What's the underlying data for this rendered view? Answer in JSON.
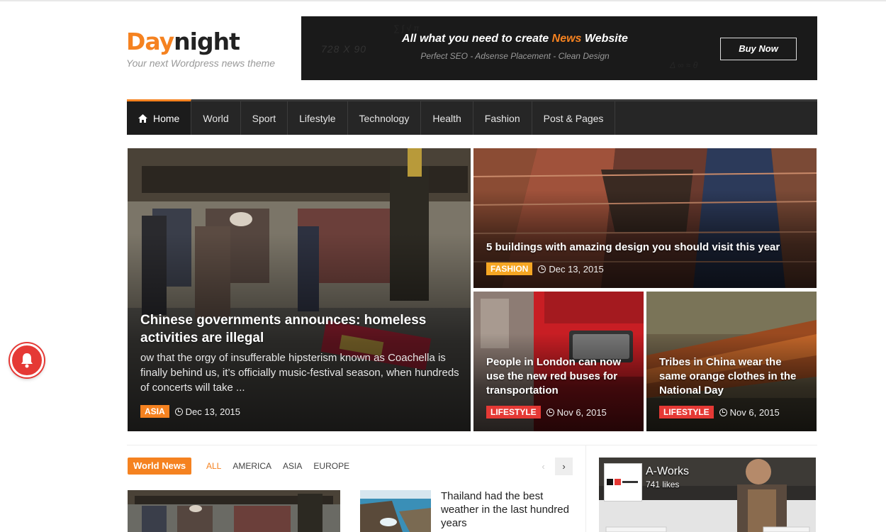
{
  "site": {
    "logo_day": "Day",
    "logo_night": "night",
    "tagline": "Your next Wordpress news theme"
  },
  "ad": {
    "size_text": "728 X 90",
    "headline_pre": "All what you need to create ",
    "headline_highlight": "News",
    "headline_post": " Website",
    "subline": "Perfect SEO - Adsense Placement - Clean Design",
    "button": "Buy Now"
  },
  "nav": {
    "items": [
      "Home",
      "World",
      "Sport",
      "Lifestyle",
      "Technology",
      "Health",
      "Fashion",
      "Post & Pages"
    ],
    "active": "Home"
  },
  "featured": {
    "main": {
      "title": "Chinese governments announces: homeless activities are illegal",
      "excerpt": "ow that the orgy of insufferable hipsterism known as Coachella is finally behind us, it’s officially music-festival season, when hundreds of concerts will take ...",
      "category": "ASIA",
      "date": "Dec 13, 2015"
    },
    "top_right": {
      "title": "5 buildings with amazing design you should visit this year",
      "category": "FASHION",
      "date": "Dec 13, 2015"
    },
    "bottom_left": {
      "title": "People in London can now use the new red buses for transportation",
      "category": "LIFESTYLE",
      "date": "Nov 6, 2015"
    },
    "bottom_right": {
      "title": "Tribes in China wear the same orange clothes in the National Day",
      "category": "LIFESTYLE",
      "date": "Nov 6, 2015"
    }
  },
  "world_news": {
    "label": "World News",
    "filters": [
      "ALL",
      "AMERICA",
      "ASIA",
      "EUROPE"
    ],
    "active_filter": "ALL",
    "prev": "‹",
    "next": "›",
    "side_title": "Thailand had the best weather in the last hundred years"
  },
  "fb_widget": {
    "name": "A-Works",
    "likes": "741 likes"
  },
  "colors": {
    "accent": "#f58220",
    "nav_bg": "#262626",
    "badge_red": "#e53935",
    "badge_yellow": "#f5a623"
  },
  "icons": {
    "home": "home-icon",
    "clock": "clock-icon",
    "bell": "bell-icon"
  }
}
